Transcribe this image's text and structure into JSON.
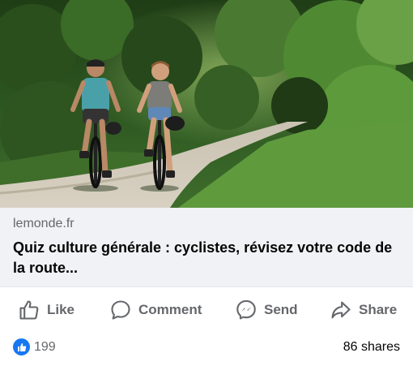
{
  "link_preview": {
    "domain": "lemonde.fr",
    "headline": "Quiz culture générale : cyclistes, révisez votre code de la route..."
  },
  "actions": {
    "like": "Like",
    "comment": "Comment",
    "send": "Send",
    "share": "Share"
  },
  "stats": {
    "reactions_count": "199",
    "shares": "86 shares"
  },
  "colors": {
    "accent": "#1877f2",
    "secondary_text": "#65676b",
    "preview_background": "#f0f2f5"
  },
  "icons": {
    "like": "thumbs-up-icon",
    "comment": "comment-bubble-icon",
    "send": "messenger-icon",
    "share": "share-arrow-icon",
    "reaction": "like-reaction-icon"
  }
}
